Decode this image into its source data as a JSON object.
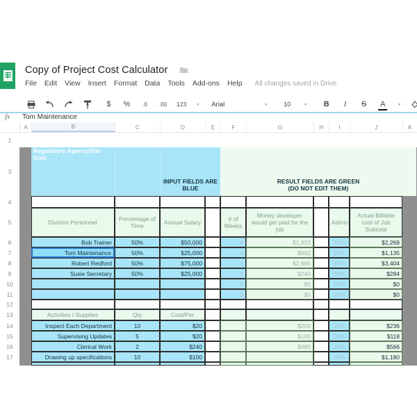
{
  "app": {
    "logo_icon": "google-sheets-icon",
    "doc_title": "Copy of Project Cost Calculator",
    "folder_icon": "move-to-folder-icon",
    "save_state": "All changes saved in Drive",
    "menus": [
      "File",
      "Edit",
      "View",
      "Insert",
      "Format",
      "Data",
      "Tools",
      "Add-ons",
      "Help"
    ]
  },
  "toolbar": {
    "print": "print-icon",
    "undo": "undo-icon",
    "redo": "redo-icon",
    "paint_format": "paint-format-icon",
    "currency": "$",
    "percent": "%",
    "decrease_decimal": ".0",
    "increase_decimal": ".00",
    "more_formats": "123",
    "font_family": "Arial",
    "font_size": "10",
    "bold": "B",
    "italic": "I",
    "strikethrough": "S",
    "text_color": "A",
    "fill_color": "fill-color-icon",
    "borders": "borders-icon",
    "merge": "merge-cells-icon",
    "halign": "horizontal-align-icon",
    "valign": "vertical-align-icon",
    "wrap": "text-wrap-icon"
  },
  "formula_bar": {
    "fx_label": "fx",
    "value": "Tom Maintenance"
  },
  "grid": {
    "columns": [
      "A",
      "B",
      "C",
      "D",
      "E",
      "F",
      "G",
      "H",
      "I",
      "J",
      "K"
    ],
    "selected_column": "B",
    "row_numbers": [
      "1",
      "3",
      "4",
      "5",
      "6",
      "7",
      "8",
      "9",
      "10",
      "11",
      "12",
      "13",
      "14",
      "15",
      "16",
      "17"
    ],
    "title_cell": "Regulatory AgencySite Visit",
    "banner_input": "INPUT FIELDS ARE BLUE",
    "banner_result_line1": "RESULT FIELDS ARE GREEN",
    "banner_result_line2": "(DO NOT EDIT THEM)",
    "headers": {
      "personnel": "Division Personnel",
      "percentage": "Percentage of Time",
      "salary": "Annual Salary",
      "weeks": "# of Weeks",
      "money": "Money developer would get paid for the job",
      "admin": "Admin",
      "subtotal": "Actual Billable cost of Job Subtotal"
    },
    "personnel_rows": [
      {
        "row": "6",
        "name": "Bob Trainer",
        "pct": "50%",
        "salary": "$50,000",
        "weeks": "4",
        "money": "$1,923",
        "admin": "18%",
        "subtotal": "$2,269"
      },
      {
        "row": "7",
        "name": "Tom Maintenance",
        "pct": "50%",
        "salary": "$25,000",
        "weeks": "4",
        "money": "$962",
        "admin": "18%",
        "subtotal": "$1,135"
      },
      {
        "row": "8",
        "name": "Robert Redford",
        "pct": "50%",
        "salary": "$75,000",
        "weeks": "4",
        "money": "$2,885",
        "admin": "18%",
        "subtotal": "$3,404"
      },
      {
        "row": "9",
        "name": "Susie Secretary",
        "pct": "50%",
        "salary": "$25,000",
        "weeks": "1",
        "money": "$240",
        "admin": "18%",
        "subtotal": "$284"
      },
      {
        "row": "10",
        "name": "",
        "pct": "",
        "salary": "",
        "weeks": "0",
        "money": "$0",
        "admin": "18%",
        "subtotal": "$0"
      },
      {
        "row": "11",
        "name": "",
        "pct": "",
        "salary": "",
        "weeks": "0",
        "money": "$0",
        "admin": "18%",
        "subtotal": "$0"
      }
    ],
    "activity_headers": {
      "activities": "Activities / Supplies",
      "qty": "Qty",
      "cost_per": "Cost/Per"
    },
    "activity_rows": [
      {
        "row": "14",
        "name": "Inspect Each Department",
        "qty": "10",
        "cost": "$20",
        "money": "$200",
        "admin": "18%",
        "subtotal": "$236"
      },
      {
        "row": "15",
        "name": "Supervising Updates",
        "qty": "5",
        "cost": "$20",
        "money": "$100",
        "admin": "18%",
        "subtotal": "$118"
      },
      {
        "row": "16",
        "name": "Clerical Work",
        "qty": "2",
        "cost": "$240",
        "money": "$480",
        "admin": "18%",
        "subtotal": "$566"
      },
      {
        "row": "17",
        "name": "Drawing up specifications",
        "qty": "10",
        "cost": "$100",
        "money": "",
        "admin": "18%",
        "subtotal": "$1,180"
      }
    ]
  },
  "colors": {
    "brand_green": "#1fa463",
    "input_blue": "#a9e5f8",
    "result_green": "#e9f9ec"
  }
}
